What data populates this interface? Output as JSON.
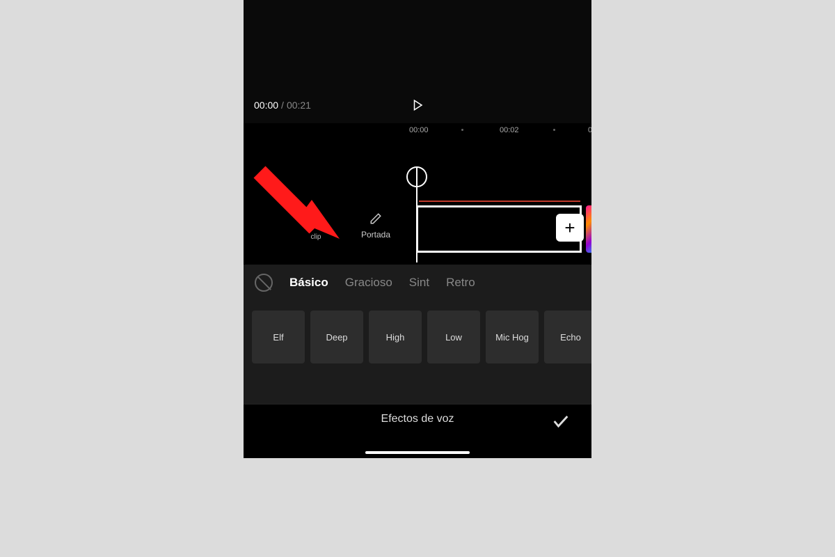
{
  "player": {
    "current_time": "00:00",
    "total_time": "00:21"
  },
  "ruler": {
    "marks": [
      "00:00",
      "00:02"
    ]
  },
  "timeline": {
    "portada_label": "Portada",
    "clip_label_suffix": "clip",
    "add_icon": "+"
  },
  "tabs": {
    "active": "Básico",
    "items": [
      "Básico",
      "Gracioso",
      "Sint",
      "Retro"
    ]
  },
  "effects": [
    "Elf",
    "Deep",
    "High",
    "Low",
    "Mic Hog",
    "Echo"
  ],
  "footer": {
    "title": "Efectos de voz"
  }
}
